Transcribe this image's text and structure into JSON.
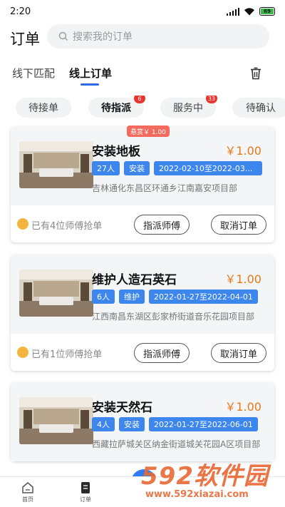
{
  "status_bar": {
    "time": "2:20",
    "battery": "69"
  },
  "header": {
    "title": "订单",
    "search_placeholder": "搜索我的订单"
  },
  "top_tabs": [
    {
      "label": "线下匹配"
    },
    {
      "label": "线上订单"
    }
  ],
  "status_pills": [
    {
      "label": "待接单",
      "badge": ""
    },
    {
      "label": "待指派",
      "badge": "6"
    },
    {
      "label": "服务中",
      "badge": "33"
    },
    {
      "label": "待确认",
      "badge": ""
    }
  ],
  "orders": [
    {
      "title": "安装地板",
      "price": "￥1.00",
      "reward": "悬赏￥ 1.00",
      "tags": {
        "people": "27人",
        "type": "安装",
        "dates": "2022-02-10至2022-03..."
      },
      "address": "吉林通化东昌区环通乡江南嘉安项目部",
      "grab_text": "已有4位师傅抢单",
      "assign_label": "指派师傅",
      "cancel_label": "取消订单"
    },
    {
      "title": "维护人造石英石",
      "price": "￥1.00",
      "reward": "",
      "tags": {
        "people": "6人",
        "type": "维护",
        "dates": "2022-01-27至2022-04-01"
      },
      "address": "江西南昌东湖区彭家桥街道音乐花园项目部",
      "grab_text": "已有1位师傅抢单",
      "assign_label": "指派师傅",
      "cancel_label": "取消订单"
    },
    {
      "title": "安装天然石",
      "price": "￥1.00",
      "reward": "",
      "tags": {
        "people": "4人",
        "type": "安装",
        "dates": "2022-01-27至2022-06-01"
      },
      "address": "西藏拉萨城关区纳金街道城关花园A区项目部",
      "grab_text": "",
      "assign_label": "",
      "cancel_label": ""
    }
  ],
  "bottom_nav": [
    {
      "label": "首页"
    },
    {
      "label": "订单"
    }
  ],
  "watermark": {
    "brand_num": "592",
    "brand_text": "软件园",
    "url": "www.592xiazai.com"
  },
  "colors": {
    "accent": "#2b6be8",
    "tag": "#3d86ee",
    "price": "#e37a1c",
    "badge": "#e8362e"
  }
}
